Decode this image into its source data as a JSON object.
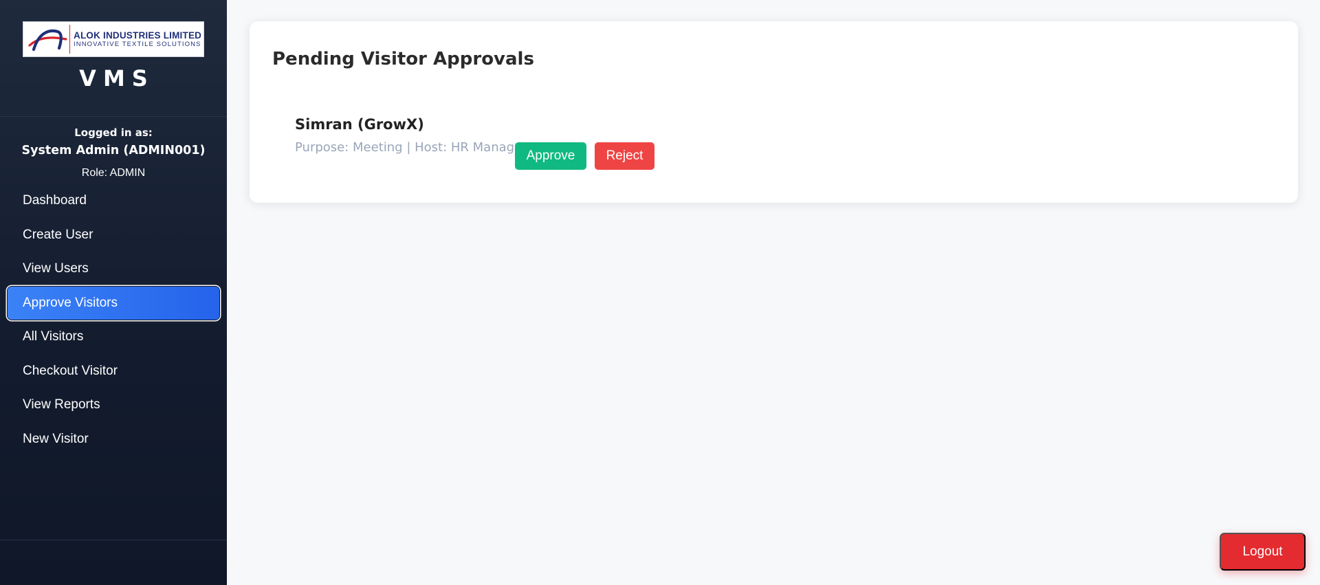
{
  "brand": {
    "company_name": "ALOK INDUSTRIES LIMITED",
    "tagline": "INNOVATIVE TEXTILE SOLUTIONS",
    "app_title": "VMS",
    "logo_icon": "alok-logo-icon"
  },
  "user": {
    "logged_label": "Logged in as:",
    "name": "System Admin (ADMIN001)",
    "role": "Role: ADMIN"
  },
  "nav": {
    "items": [
      {
        "label": "Dashboard",
        "active": false
      },
      {
        "label": "Create User",
        "active": false
      },
      {
        "label": "View Users",
        "active": false
      },
      {
        "label": "Approve Visitors",
        "active": true
      },
      {
        "label": "All Visitors",
        "active": false
      },
      {
        "label": "Checkout Visitor",
        "active": false
      },
      {
        "label": "View Reports",
        "active": false
      },
      {
        "label": "New Visitor",
        "active": false
      }
    ]
  },
  "main": {
    "title": "Pending Visitor Approvals",
    "pending": [
      {
        "name": "Simran (GrowX)",
        "details": "Purpose: Meeting | Host: HR Manager",
        "approve_label": "Approve",
        "reject_label": "Reject"
      }
    ]
  },
  "logout_label": "Logout",
  "colors": {
    "sidebar_bg": "#1a2437",
    "active_nav": "#2563eb",
    "approve": "#10b981",
    "reject": "#ef4444",
    "logout": "#e32b30",
    "muted_text": "#9aa5b8"
  }
}
